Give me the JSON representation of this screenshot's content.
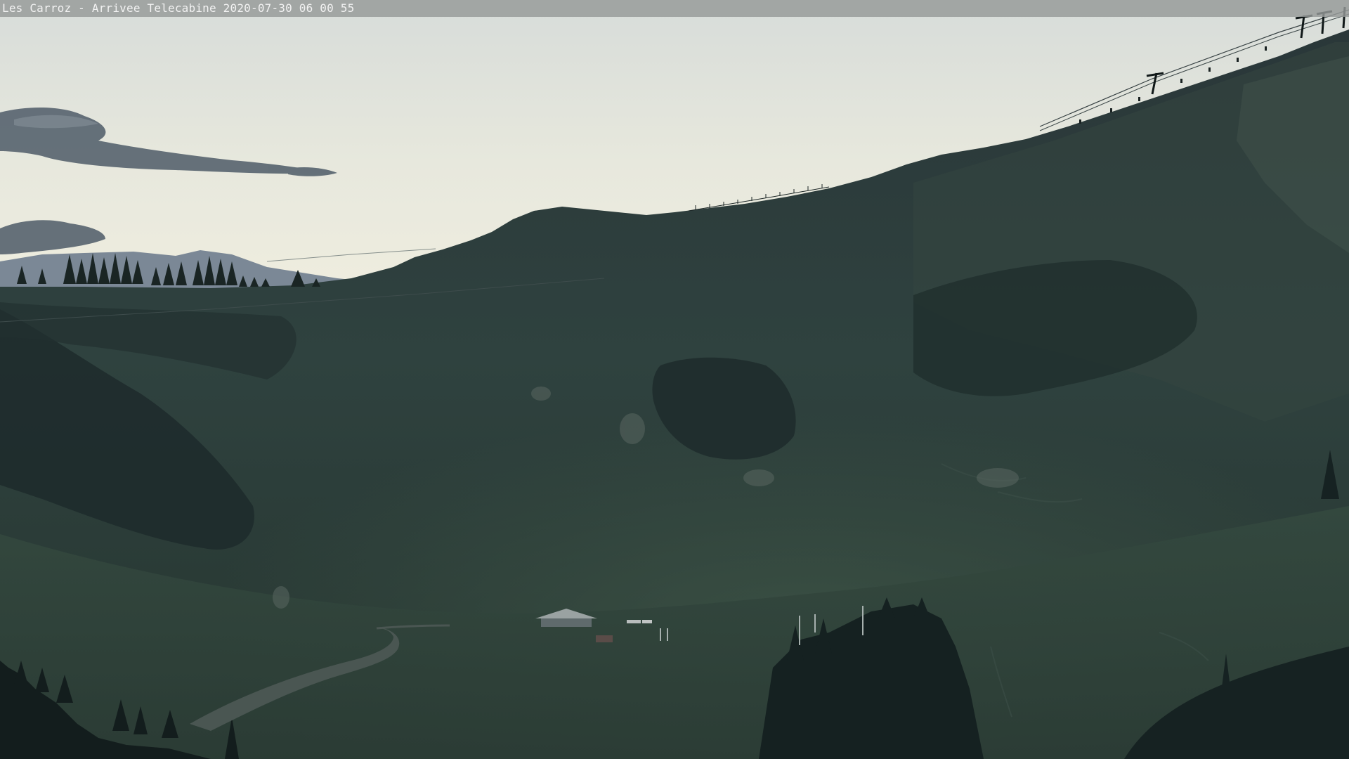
{
  "overlay": {
    "caption": "Les Carroz - Arrivee Telecabine 2020-07-30 06 00 55"
  },
  "palette": {
    "sky_top": "#d9ddd8",
    "sky_horizon": "#ecebdc",
    "cloud": "#4c5a66",
    "far_ridge": "#7d8a98",
    "hillside": "#2b3c3c",
    "meadow": "#35483f",
    "forest": "#1a2626"
  },
  "scene": {
    "subjects": [
      "mountain-ridge",
      "lift-towers",
      "forest",
      "chalet",
      "gravel-road"
    ]
  }
}
